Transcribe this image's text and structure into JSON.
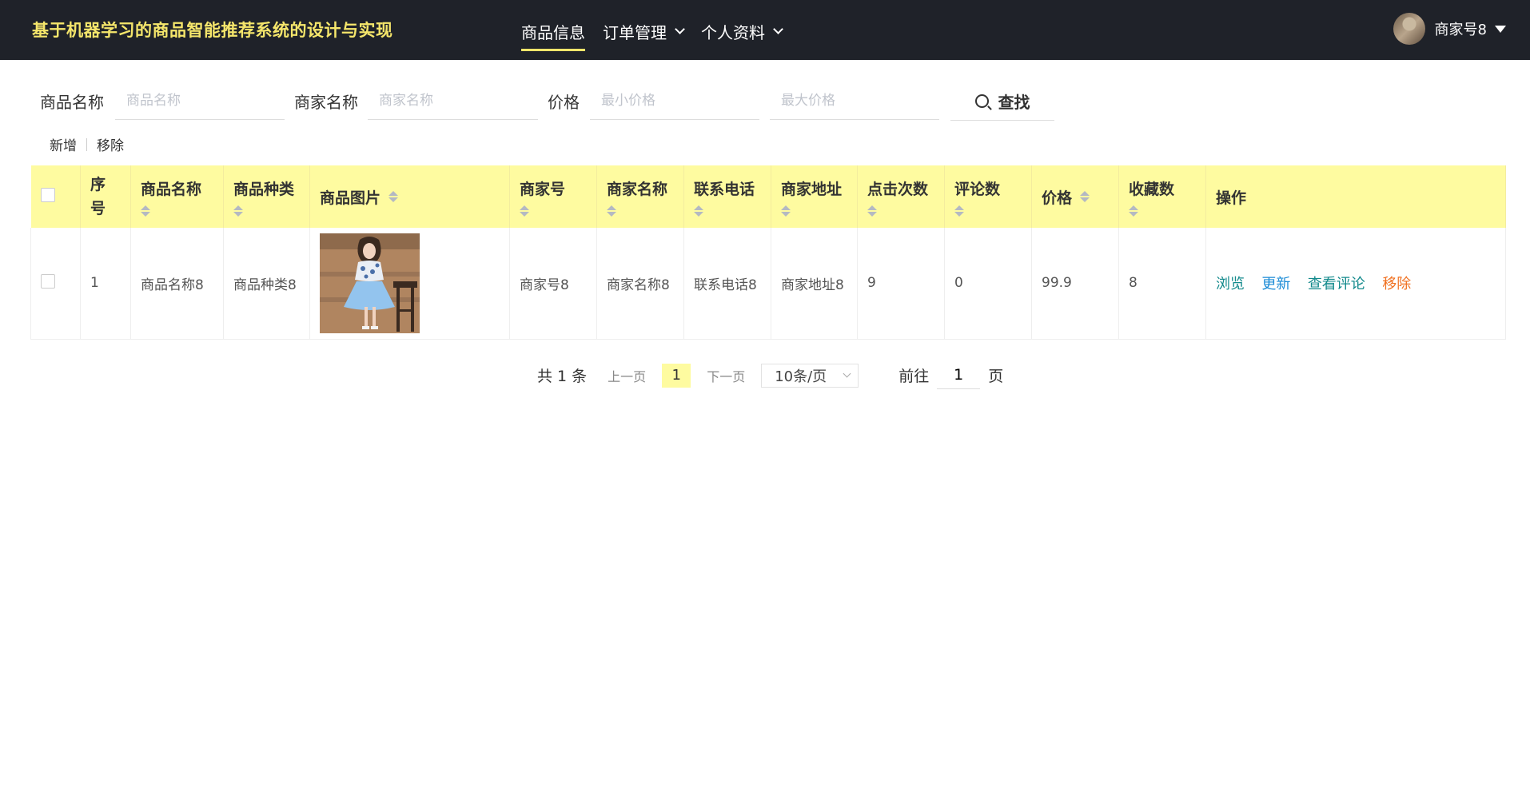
{
  "header": {
    "title": "基于机器学习的商品智能推荐系统的设计与实现",
    "nav": [
      {
        "label": "商品信息",
        "active": true,
        "dropdown": false
      },
      {
        "label": "订单管理",
        "active": false,
        "dropdown": true
      },
      {
        "label": "个人资料",
        "active": false,
        "dropdown": true
      }
    ],
    "user": {
      "name": "商家号8"
    }
  },
  "search": {
    "product_name": {
      "label": "商品名称",
      "placeholder": "商品名称",
      "value": ""
    },
    "merchant_name": {
      "label": "商家名称",
      "placeholder": "商家名称",
      "value": ""
    },
    "price": {
      "label": "价格",
      "min_placeholder": "最小价格",
      "max_placeholder": "最大价格"
    },
    "button": "查找"
  },
  "toolbar": {
    "add": "新增",
    "remove": "移除"
  },
  "table": {
    "columns": [
      "序号",
      "商品名称",
      "商品种类",
      "商品图片",
      "商家号",
      "商家名称",
      "联系电话",
      "商家地址",
      "点击次数",
      "评论数",
      "价格",
      "收藏数",
      "操作"
    ],
    "rows": [
      {
        "index": "1",
        "product_name": "商品名称8",
        "category": "商品种类8",
        "image": "dress-photo",
        "merchant_no": "商家号8",
        "merchant_name": "商家名称8",
        "phone": "联系电话8",
        "address": "商家地址8",
        "clicks": "9",
        "comments": "0",
        "price": "99.9",
        "favorites": "8",
        "ops": [
          "浏览",
          "更新",
          "查看评论",
          "移除"
        ]
      }
    ]
  },
  "pagination": {
    "total": "共 1 条",
    "prev": "上一页",
    "current": "1",
    "next": "下一页",
    "page_size": "10条/页",
    "goto_prefix": "前往",
    "goto_value": "1",
    "goto_suffix": "页"
  },
  "colors": {
    "topbar": "#1f2229",
    "accent": "#f5e66b",
    "table_header": "#fefba0"
  }
}
